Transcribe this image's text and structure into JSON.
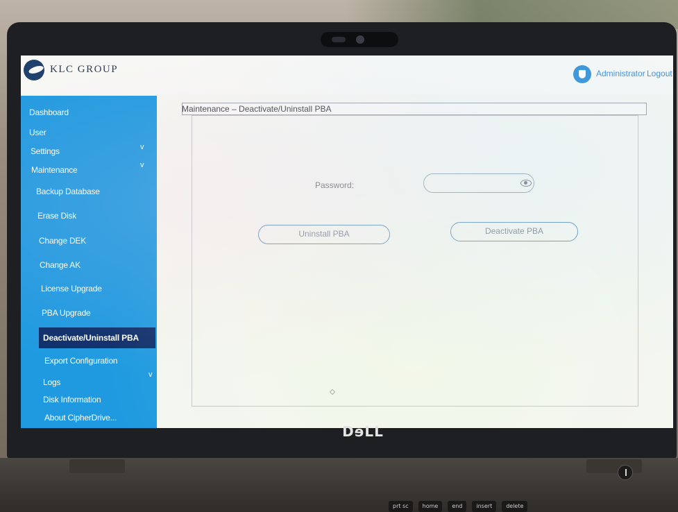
{
  "app": {
    "brand": "KLC GROUP",
    "user_label": "Administrator",
    "logout_label": "Logout"
  },
  "sidebar": {
    "items": [
      {
        "label": "Dashboard"
      },
      {
        "label": "User"
      },
      {
        "label": "Settings",
        "expandable": true
      },
      {
        "label": "Maintenance",
        "expandable": true,
        "expanded": true
      },
      {
        "label": "Logs",
        "expandable": true
      },
      {
        "label": "Disk Information"
      },
      {
        "label": "About CipherDrive..."
      }
    ],
    "maintenance_sub": [
      {
        "label": "Backup Database"
      },
      {
        "label": "Erase Disk"
      },
      {
        "label": "Change DEK"
      },
      {
        "label": "Change AK"
      },
      {
        "label": "License Upgrade"
      },
      {
        "label": "PBA Upgrade"
      },
      {
        "label": "Deactivate/Uninstall PBA",
        "active": true
      },
      {
        "label": "Export Configuration"
      }
    ],
    "chevron": "v"
  },
  "main": {
    "breadcrumb": "Maintenance – Deactivate/Uninstall PBA",
    "password_label": "Password:",
    "password_value": "",
    "uninstall_button": "Uninstall PBA",
    "deactivate_button": "Deactivate PBA"
  },
  "device": {
    "logo": "DɘLL",
    "keys": [
      "prt sc",
      "home",
      "end",
      "insert",
      "delete"
    ]
  },
  "colors": {
    "sidebar": "#1f9ae0",
    "active_item": "#0e2f6b",
    "accent": "#3b8ad8",
    "brand_dark": "#1d3f6b"
  },
  "icons": {
    "brand": "klc-logo-icon",
    "user": "shield-user-icon",
    "password_toggle": "eye-icon",
    "expand": "chevron-down-icon"
  }
}
